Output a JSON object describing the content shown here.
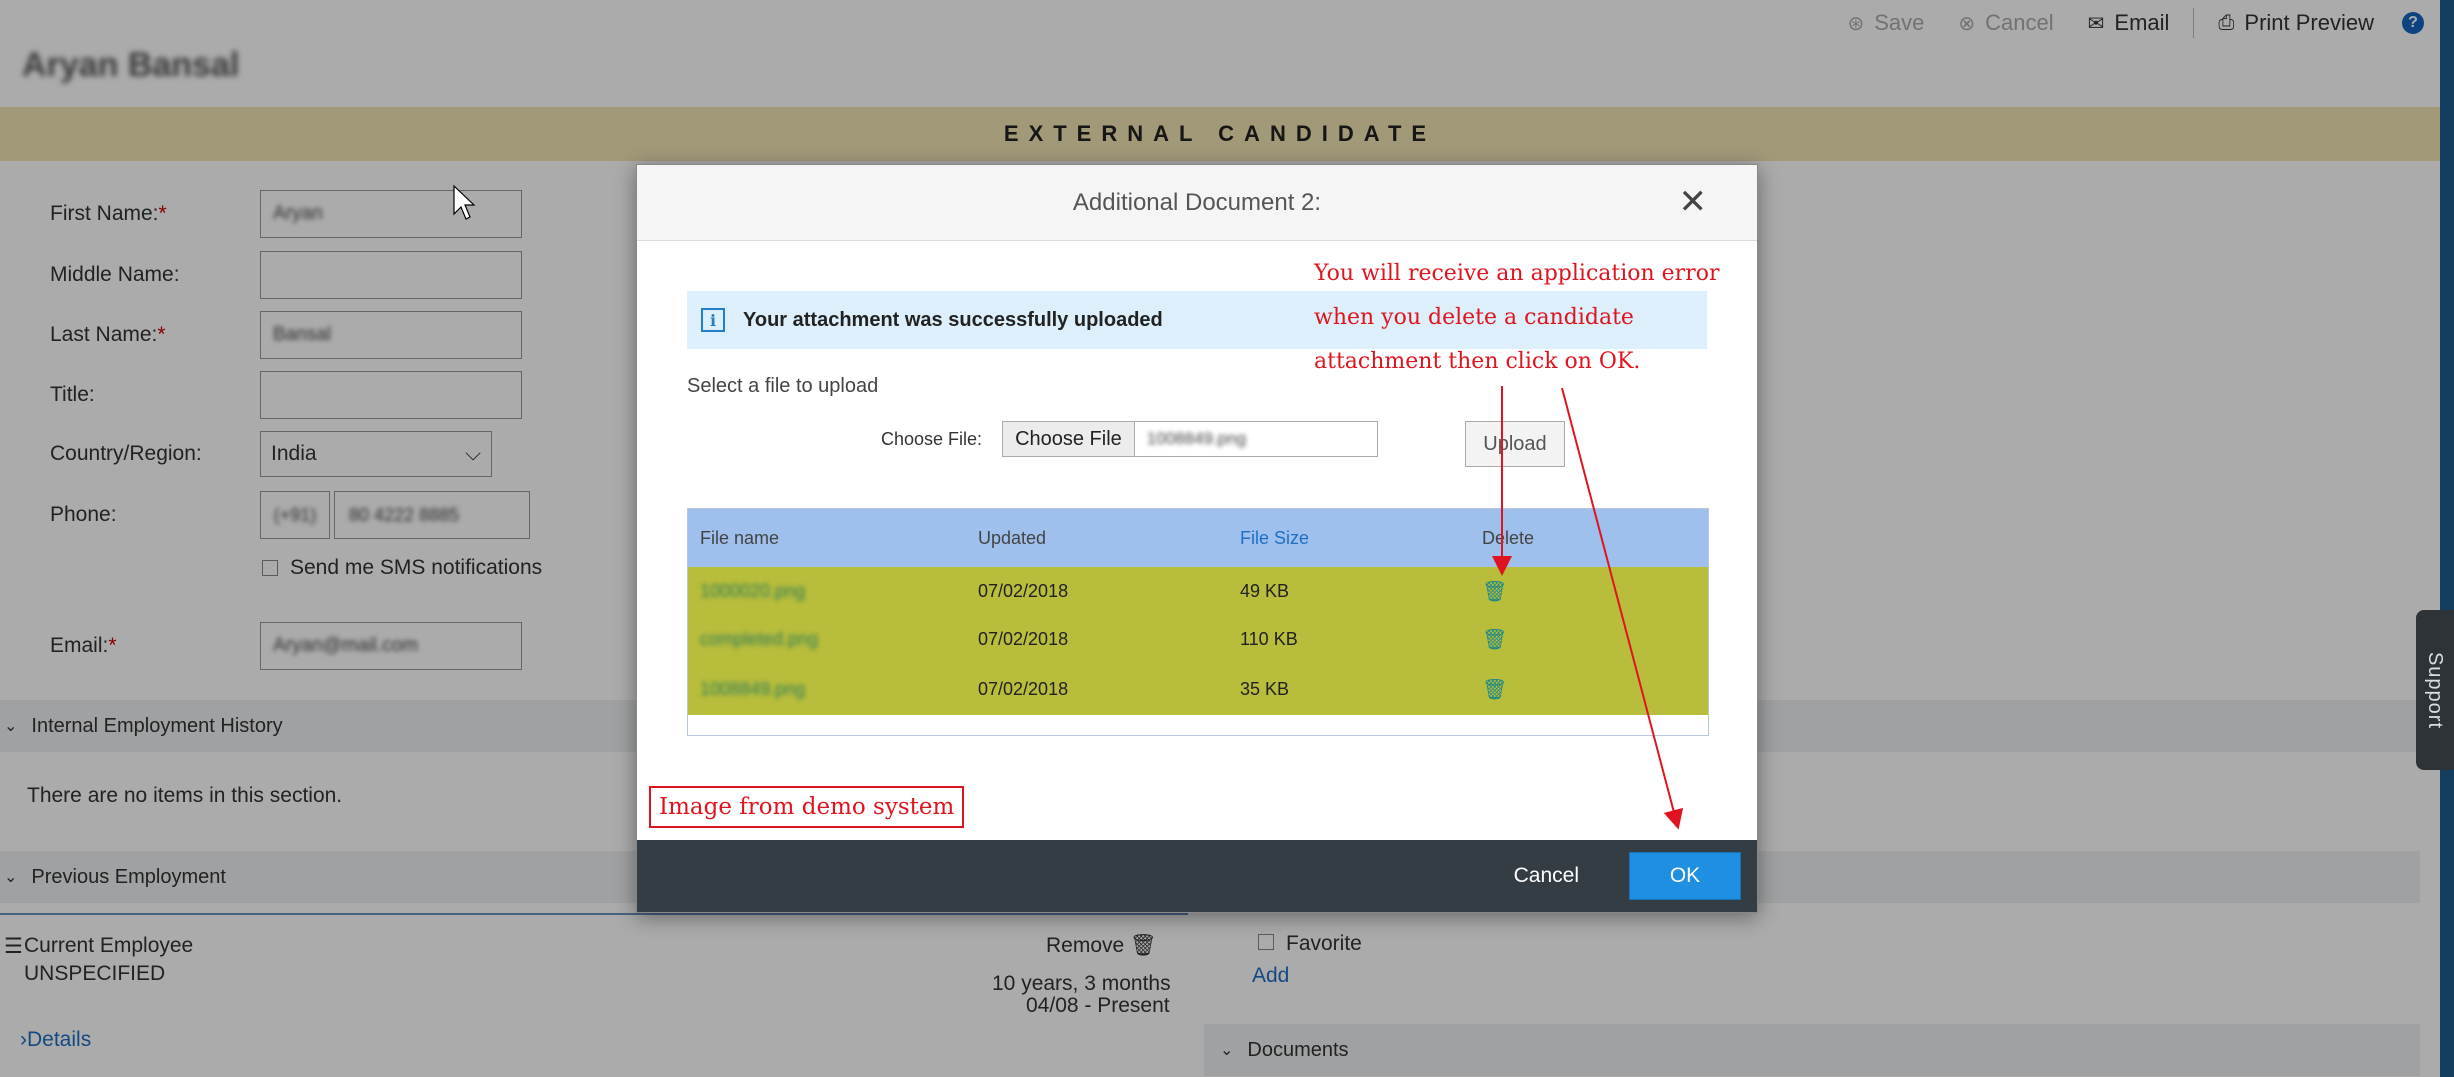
{
  "toolbar": {
    "save": "Save",
    "cancel": "Cancel",
    "email": "Email",
    "print_preview": "Print Preview"
  },
  "candidate_name": "Aryan Bansal",
  "banner": "EXTERNAL CANDIDATE",
  "form": {
    "first_name_label": "First Name:",
    "first_name_value": "Aryan",
    "middle_name_label": "Middle Name:",
    "last_name_label": "Last Name:",
    "last_name_value": "Bansal",
    "title_label": "Title:",
    "country_label": "Country/Region:",
    "country_value": "India",
    "phone_label": "Phone:",
    "phone_code": "(+91)",
    "phone_number": "80 4222 8885",
    "sms_label": "Send me SMS notifications",
    "email_label": "Email:",
    "email_value": "Aryan@mail.com",
    "required_mark": "*"
  },
  "sections": {
    "internal_history": "Internal Employment History",
    "no_items": "There are no items in this section.",
    "previous_employment": "Previous Employment",
    "current_employee": "Current Employee",
    "unspecified": "UNSPECIFIED",
    "remove": "Remove",
    "duration": "10 years, 3 months",
    "period": "04/08 - Present",
    "details": "Details",
    "favorite": "Favorite",
    "add": "Add",
    "documents": "Documents"
  },
  "dialog": {
    "title": "Additional Document 2:",
    "message": "Your attachment was successfully uploaded",
    "select_label": "Select a file to upload",
    "choose_label": "Choose File:",
    "choose_button": "Choose File",
    "chosen_file": "1008849.png",
    "upload_button": "Upload",
    "table": {
      "headers": [
        "File name",
        "Updated",
        "File Size",
        "Delete"
      ],
      "rows": [
        {
          "name": "1000020.png",
          "updated": "07/02/2018",
          "size": "49 KB"
        },
        {
          "name": "completed.png",
          "updated": "07/02/2018",
          "size": "110 KB"
        },
        {
          "name": "1008849.png",
          "updated": "07/02/2018",
          "size": "35 KB"
        }
      ]
    },
    "cancel_button": "Cancel",
    "ok_button": "OK"
  },
  "annotation": {
    "line1": "You will receive an application error",
    "line2": "when you delete a candidate",
    "line3": "attachment then click on OK.",
    "demo_label": "Image from demo system"
  },
  "support": "Support",
  "colors": {
    "banner": "#f1e4b3",
    "table_header": "#9fbfec",
    "table_row": "#b8bd3b",
    "ok_button": "#1e8fe1",
    "annotation_red": "#e0141e"
  }
}
